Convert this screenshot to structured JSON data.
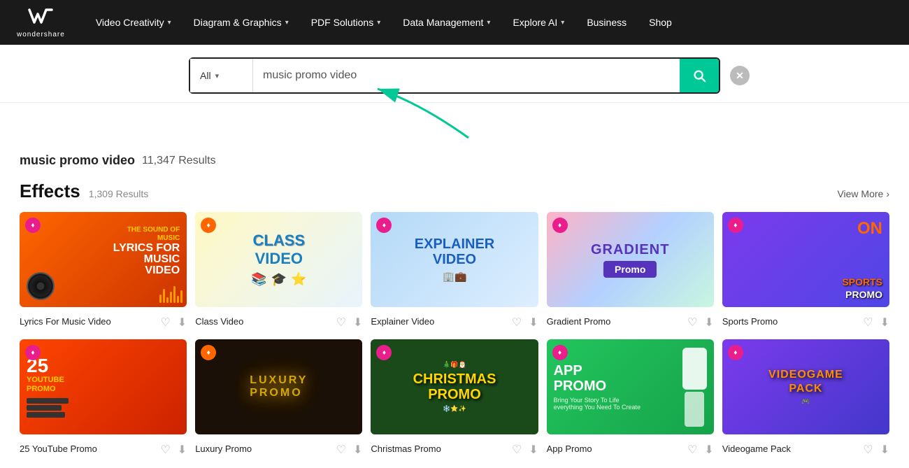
{
  "brand": {
    "logo_icon": "W",
    "logo_name": "wondershare"
  },
  "nav": {
    "items": [
      {
        "label": "Video Creativity",
        "has_dropdown": true
      },
      {
        "label": "Diagram & Graphics",
        "has_dropdown": true
      },
      {
        "label": "PDF Solutions",
        "has_dropdown": true
      },
      {
        "label": "Data Management",
        "has_dropdown": true
      },
      {
        "label": "Explore AI",
        "has_dropdown": true
      },
      {
        "label": "Business",
        "has_dropdown": false
      },
      {
        "label": "Shop",
        "has_dropdown": false
      }
    ]
  },
  "search": {
    "category_label": "All",
    "category_placeholder": "All",
    "input_value": "music promo video",
    "clear_title": "Clear search"
  },
  "results": {
    "query": "music promo video",
    "total": "11,347 Results"
  },
  "effects_section": {
    "title": "Effects",
    "count": "1,309 Results",
    "view_more": "View More"
  },
  "cards_row1": [
    {
      "id": "lyrics-music-video",
      "title": "Lyrics For Music Video",
      "thumb_label": "LYRICS FOR MUSIC VIDEO",
      "thumb_class": "thumb-lyrics",
      "text_class": "lyrics"
    },
    {
      "id": "class-video",
      "title": "Class Video",
      "thumb_label": "CLASS VIDEO",
      "thumb_class": "thumb-class",
      "text_class": "class-t"
    },
    {
      "id": "explainer-video",
      "title": "Explainer Video",
      "thumb_label": "EXPLAINER VIDEO",
      "thumb_class": "thumb-explainer",
      "text_class": "explainer"
    },
    {
      "id": "gradient-promo",
      "title": "Gradient Promo",
      "thumb_label": "GRADIENT Promo",
      "thumb_class": "thumb-gradient",
      "text_class": "gradient-t"
    },
    {
      "id": "sports-promo",
      "title": "Sports Promo",
      "thumb_label": "SPORTS PROMO",
      "thumb_class": "thumb-sports",
      "text_class": "sports"
    }
  ],
  "cards_row2": [
    {
      "id": "youtube-promo",
      "title": "25 YouTube Promo",
      "thumb_label": "25 YOUTUBE PROMO",
      "thumb_class": "thumb-youtube",
      "text_class": "youtube-t"
    },
    {
      "id": "luxury-promo",
      "title": "Luxury Promo",
      "thumb_label": "LUXURY PROMO",
      "thumb_class": "thumb-luxury",
      "text_class": "luxury"
    },
    {
      "id": "christmas-promo",
      "title": "Christmas Promo",
      "thumb_label": "CHRISTMAS PROMO",
      "thumb_class": "thumb-christmas",
      "text_class": "christmas"
    },
    {
      "id": "app-promo",
      "title": "App Promo",
      "thumb_label": "APP PROMO",
      "thumb_class": "thumb-app",
      "text_class": "app-t"
    },
    {
      "id": "videogame-pack",
      "title": "Videogame Pack",
      "thumb_label": "VIDEOGAME PACK",
      "thumb_class": "thumb-videogame",
      "text_class": "videogame"
    }
  ]
}
